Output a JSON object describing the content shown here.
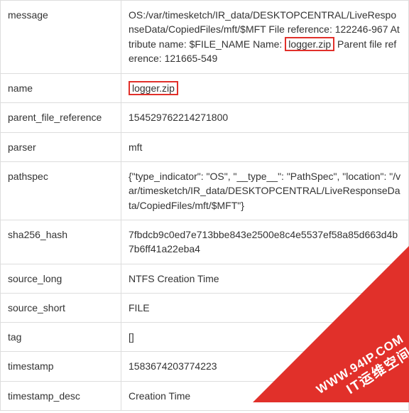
{
  "rows": {
    "message": {
      "key": "message",
      "prefix": "OS:/var/timesketch/IR_data/DESKTOPCENTRAL/LiveResponseData/CopiedFiles/mft/$MFT File reference: 122246-967 Attribute name: $FILE_NAME Name:",
      "highlight": "logger.zip",
      "suffix": " Parent file reference: 121665-549"
    },
    "name": {
      "key": "name",
      "highlight": "logger.zip"
    },
    "parent_file_reference": {
      "key": "parent_file_reference",
      "value": "154529762214271800"
    },
    "parser": {
      "key": "parser",
      "value": "mft"
    },
    "pathspec": {
      "key": "pathspec",
      "value": "{\"type_indicator\": \"OS\", \"__type__\": \"PathSpec\", \"location\": \"/var/timesketch/IR_data/DESKTOPCENTRAL/LiveResponseData/CopiedFiles/mft/$MFT\"}"
    },
    "sha256_hash": {
      "key": "sha256_hash",
      "value": "7fbdcb9c0ed7e713bbe843e2500e8c4e5537ef58a85d663d4b7b6ff41a22eba4"
    },
    "source_long": {
      "key": "source_long",
      "value": "NTFS Creation Time"
    },
    "source_short": {
      "key": "source_short",
      "value": "FILE"
    },
    "tag": {
      "key": "tag",
      "value": "[]"
    },
    "timestamp": {
      "key": "timestamp",
      "value": "1583674203774223"
    },
    "timestamp_desc": {
      "key": "timestamp_desc",
      "value": "Creation Time"
    }
  },
  "watermark": {
    "line1": "WWW.94IP.COM",
    "line2": "IT运维空间"
  }
}
